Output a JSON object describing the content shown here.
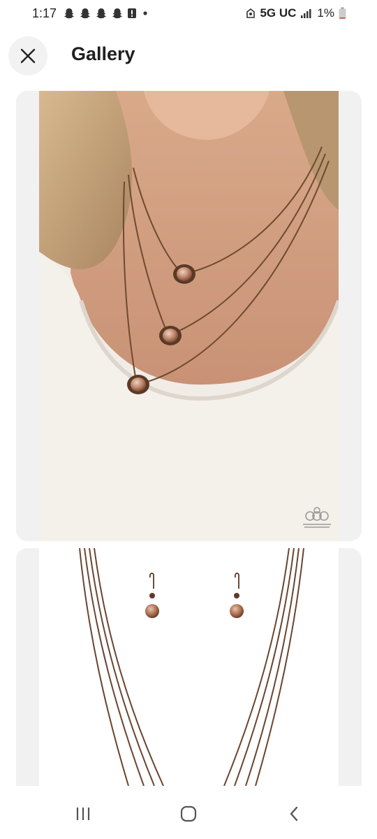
{
  "status_bar": {
    "time": "1:17",
    "network": "5G UC",
    "battery": "1%",
    "notification_icons": [
      "snapchat-icon",
      "snapchat-icon",
      "snapchat-icon",
      "snapchat-icon",
      "alert-icon",
      "dot-icon"
    ]
  },
  "header": {
    "title": "Gallery",
    "close_icon": "close-icon"
  },
  "gallery": {
    "images": [
      {
        "subject": "layered copper necklace worn on model",
        "watermark": "crown-logo-icon"
      },
      {
        "subject": "copper necklace chains with earrings"
      }
    ]
  },
  "nav_bar": {
    "items": [
      "recent-apps-icon",
      "home-icon",
      "back-icon"
    ]
  },
  "colors": {
    "card_bg": "#f1f1f1",
    "copper": "#8a5a3a",
    "title": "#1f1f1f"
  }
}
